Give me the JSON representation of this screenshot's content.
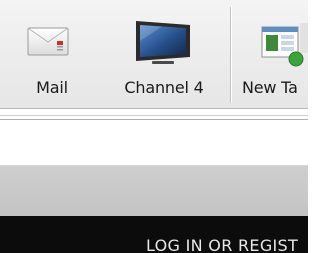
{
  "toolbar": {
    "items": [
      {
        "label": "Mail",
        "icon": "mail-icon"
      },
      {
        "label": "Channel 4",
        "icon": "monitor-icon"
      },
      {
        "label": "New Ta",
        "icon": "new-tab-icon"
      }
    ]
  },
  "page": {
    "login_text": "LOG IN OR REGIST"
  },
  "colors": {
    "toolbar_bg": "#eeeeee",
    "grey_band": "#c8c8c8",
    "black_bar": "#0c0c0c",
    "mail_flag": "#d42a2a"
  }
}
